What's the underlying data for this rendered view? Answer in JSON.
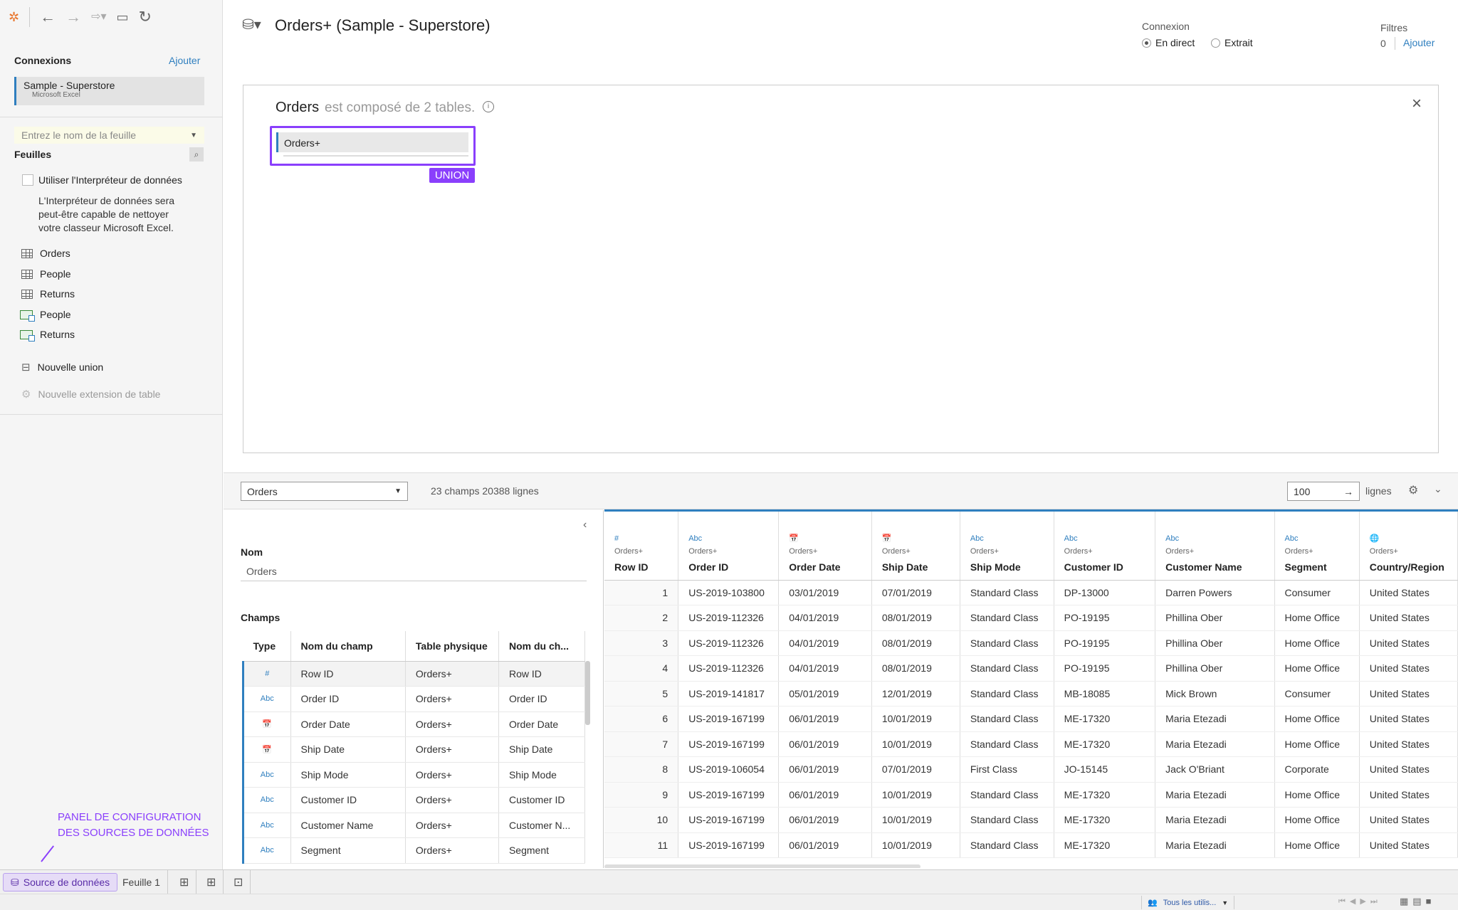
{
  "header": {
    "title": "Orders+ (Sample - Superstore)"
  },
  "connection_mode": {
    "label": "Connexion",
    "live": "En direct",
    "extract": "Extrait"
  },
  "filters": {
    "label": "Filtres",
    "count": "0",
    "add": "Ajouter"
  },
  "left": {
    "connections_title": "Connexions",
    "add_label": "Ajouter",
    "connection_name": "Sample - Superstore",
    "connection_type": "Microsoft Excel",
    "sheet_search_placeholder": "Entrez le nom de la feuille",
    "sheets_title": "Feuilles",
    "interpreter_label": "Utiliser l'Interpréteur de données",
    "interpreter_desc": [
      "L'Interpréteur de données sera",
      "peut-être capable de nettoyer",
      "votre classeur Microsoft Excel."
    ],
    "sheets": [
      "Orders",
      "People",
      "Returns"
    ],
    "named_ranges": [
      "People",
      "Returns"
    ],
    "new_union": "Nouvelle union",
    "new_extension": "Nouvelle extension de table"
  },
  "canvas": {
    "table_name": "Orders",
    "desc": "est composé de 2 tables.",
    "union_table": "Orders+",
    "union_badge": "UNION"
  },
  "midbar": {
    "table_select": "Orders",
    "summary": "23 champs 20388 lignes",
    "rows_value": "100",
    "rows_label": "lignes"
  },
  "fields_panel": {
    "name_label": "Nom",
    "name_value": "Orders",
    "fields_label": "Champs",
    "headers": [
      "Type",
      "Nom du champ",
      "Table physique",
      "Nom du ch..."
    ],
    "rows": [
      {
        "type": "#",
        "name": "Row ID",
        "table": "Orders+",
        "remote": "Row ID"
      },
      {
        "type": "Abc",
        "name": "Order ID",
        "table": "Orders+",
        "remote": "Order ID"
      },
      {
        "type": "📅",
        "name": "Order Date",
        "table": "Orders+",
        "remote": "Order Date"
      },
      {
        "type": "📅",
        "name": "Ship Date",
        "table": "Orders+",
        "remote": "Ship Date"
      },
      {
        "type": "Abc",
        "name": "Ship Mode",
        "table": "Orders+",
        "remote": "Ship Mode"
      },
      {
        "type": "Abc",
        "name": "Customer ID",
        "table": "Orders+",
        "remote": "Customer ID"
      },
      {
        "type": "Abc",
        "name": "Customer Name",
        "table": "Orders+",
        "remote": "Customer N..."
      },
      {
        "type": "Abc",
        "name": "Segment",
        "table": "Orders+",
        "remote": "Segment"
      }
    ]
  },
  "grid": {
    "columns": [
      {
        "icon": "#",
        "table": "Orders+",
        "name": "Row ID"
      },
      {
        "icon": "Abc",
        "table": "Orders+",
        "name": "Order ID"
      },
      {
        "icon": "📅",
        "table": "Orders+",
        "name": "Order Date"
      },
      {
        "icon": "📅",
        "table": "Orders+",
        "name": "Ship Date"
      },
      {
        "icon": "Abc",
        "table": "Orders+",
        "name": "Ship Mode"
      },
      {
        "icon": "Abc",
        "table": "Orders+",
        "name": "Customer ID"
      },
      {
        "icon": "Abc",
        "table": "Orders+",
        "name": "Customer Name"
      },
      {
        "icon": "Abc",
        "table": "Orders+",
        "name": "Segment"
      },
      {
        "icon": "🌐",
        "table": "Orders+",
        "name": "Country/Region"
      }
    ],
    "rows": [
      [
        "1",
        "US-2019-103800",
        "03/01/2019",
        "07/01/2019",
        "Standard Class",
        "DP-13000",
        "Darren Powers",
        "Consumer",
        "United States"
      ],
      [
        "2",
        "US-2019-112326",
        "04/01/2019",
        "08/01/2019",
        "Standard Class",
        "PO-19195",
        "Phillina Ober",
        "Home Office",
        "United States"
      ],
      [
        "3",
        "US-2019-112326",
        "04/01/2019",
        "08/01/2019",
        "Standard Class",
        "PO-19195",
        "Phillina Ober",
        "Home Office",
        "United States"
      ],
      [
        "4",
        "US-2019-112326",
        "04/01/2019",
        "08/01/2019",
        "Standard Class",
        "PO-19195",
        "Phillina Ober",
        "Home Office",
        "United States"
      ],
      [
        "5",
        "US-2019-141817",
        "05/01/2019",
        "12/01/2019",
        "Standard Class",
        "MB-18085",
        "Mick Brown",
        "Consumer",
        "United States"
      ],
      [
        "6",
        "US-2019-167199",
        "06/01/2019",
        "10/01/2019",
        "Standard Class",
        "ME-17320",
        "Maria Etezadi",
        "Home Office",
        "United States"
      ],
      [
        "7",
        "US-2019-167199",
        "06/01/2019",
        "10/01/2019",
        "Standard Class",
        "ME-17320",
        "Maria Etezadi",
        "Home Office",
        "United States"
      ],
      [
        "8",
        "US-2019-106054",
        "06/01/2019",
        "07/01/2019",
        "First Class",
        "JO-15145",
        "Jack O'Briant",
        "Corporate",
        "United States"
      ],
      [
        "9",
        "US-2019-167199",
        "06/01/2019",
        "10/01/2019",
        "Standard Class",
        "ME-17320",
        "Maria Etezadi",
        "Home Office",
        "United States"
      ],
      [
        "10",
        "US-2019-167199",
        "06/01/2019",
        "10/01/2019",
        "Standard Class",
        "ME-17320",
        "Maria Etezadi",
        "Home Office",
        "United States"
      ],
      [
        "11",
        "US-2019-167199",
        "06/01/2019",
        "10/01/2019",
        "Standard Class",
        "ME-17320",
        "Maria Etezadi",
        "Home Office",
        "United States"
      ]
    ]
  },
  "annotation": {
    "line1": "PANEL DE CONFIGURATION",
    "line2": "DES SOURCES DE DONNÉES",
    "color": "#8a3ffc"
  },
  "bottom_tabs": {
    "datasource": "Source de données",
    "sheet1": "Feuille 1"
  },
  "status": {
    "users": "Tous les utilis..."
  },
  "colors": {
    "accent": "#2f7fbf",
    "highlight": "#8a3ffc"
  }
}
